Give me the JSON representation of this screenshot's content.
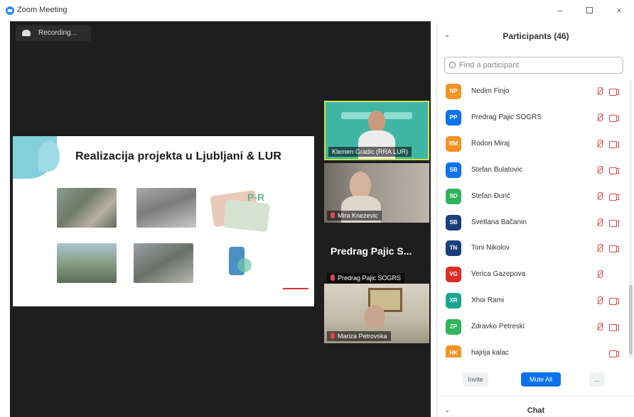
{
  "window": {
    "title": "Zoom Meeting",
    "min_symbol": "–",
    "close_symbol": "×"
  },
  "recording": {
    "label": "Recording..."
  },
  "slide": {
    "title": "Realizacija projekta u Ljubljani & LUR",
    "logo_text": "P-R"
  },
  "thumbnails": [
    {
      "name": "Klemen Gradic (RRA LUR)",
      "muted": false
    },
    {
      "name": "Mira Knezevic",
      "muted": true
    },
    {
      "name": "Predrag Pajic SOGRS",
      "muted": true,
      "big_label": "Predrag Pajic S..."
    },
    {
      "name": "Mariza Petrovska",
      "muted": true
    }
  ],
  "participants_panel": {
    "title": "Participants (46)",
    "collapse_symbol": "⌄",
    "search_placeholder": "Find a participant",
    "participants": [
      {
        "initials": "NP",
        "name": "Nedim Finjo",
        "color": "#f29324",
        "mic_muted": true,
        "video_off": true
      },
      {
        "initials": "PP",
        "name": "Predrag Pajic SOGRS",
        "color": "#0e72ed",
        "mic_muted": true,
        "video_off": true
      },
      {
        "initials": "RM",
        "name": "Rodon Miraj",
        "color": "#f29324",
        "mic_muted": true,
        "video_off": true
      },
      {
        "initials": "SB",
        "name": "Stefan Bulatovic",
        "color": "#0e72ed",
        "mic_muted": true,
        "video_off": true
      },
      {
        "initials": "SD",
        "name": "Stefan Đurić",
        "color": "#2fb35b",
        "mic_muted": true,
        "video_off": true
      },
      {
        "initials": "SB",
        "name": "Svetlana Bačanin",
        "color": "#1b3f7a",
        "mic_muted": true,
        "video_off": true
      },
      {
        "initials": "TN",
        "name": "Toni Nikolov",
        "color": "#1b3f7a",
        "mic_muted": true,
        "video_off": true
      },
      {
        "initials": "VG",
        "name": "Verica Gazepova",
        "color": "#d93025",
        "mic_muted": true,
        "video_off": false
      },
      {
        "initials": "XR",
        "name": "Xhoi Rami",
        "color": "#1aa590",
        "mic_muted": true,
        "video_off": true
      },
      {
        "initials": "ZP",
        "name": "Zdravko Petreski",
        "color": "#2fb35b",
        "mic_muted": true,
        "video_off": true
      },
      {
        "initials": "HK",
        "name": "hajrija kalac",
        "color": "#f29324",
        "mic_muted": false,
        "video_off": true
      }
    ],
    "buttons": {
      "invite": "Invite",
      "mute_all": "Mute All",
      "more": "..."
    }
  },
  "chat_panel": {
    "title": "Chat",
    "collapse_symbol": "⌄"
  }
}
